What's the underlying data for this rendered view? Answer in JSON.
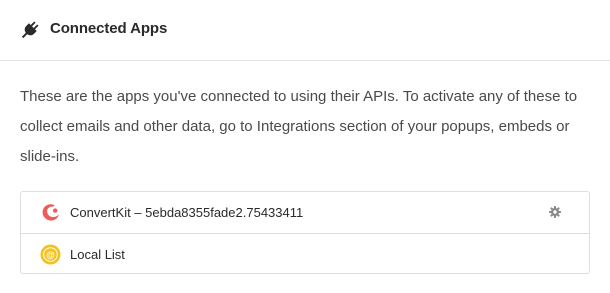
{
  "header": {
    "icon": "plug-icon",
    "title": "Connected Apps"
  },
  "description": "These are the apps you've connected to using their APIs. To activate any of these to collect emails and other data, go to Integrations section of your popups, embeds or slide-ins.",
  "apps": [
    {
      "name": "ConvertKit – 5ebda8355fade2.75433411",
      "icon": "convertkit-logo",
      "color": "#f05a5a",
      "settings_icon": "gear-icon"
    },
    {
      "name": "Local List",
      "icon": "local-list-logo",
      "color": "#f4c21b"
    }
  ]
}
